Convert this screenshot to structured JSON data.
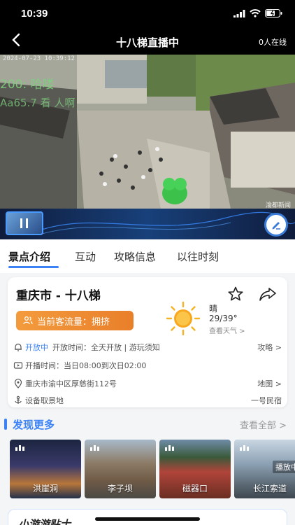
{
  "status": {
    "time": "10:39"
  },
  "nav": {
    "title": "十八梯直播中",
    "online": "0人在线"
  },
  "video": {
    "timestamp": "2024-07-23 10:39:12",
    "overlay_line1": "200: 哈喽",
    "overlay_line2": "Aa65.7 看 人啊",
    "watermark": "渝都新闻"
  },
  "tabs": [
    {
      "label": "景点介绍",
      "active": true
    },
    {
      "label": "互动",
      "active": false
    },
    {
      "label": "攻略信息",
      "active": false
    },
    {
      "label": "以往时刻",
      "active": false
    }
  ],
  "card": {
    "title": "重庆市 - 十八梯",
    "crowd_label": "当前客流量：拥挤",
    "weather": {
      "condition": "晴",
      "temp": "29/39°",
      "more": "查看天气 >"
    },
    "rows": [
      {
        "status": "开放中",
        "text": "开放时间：全天开放 | 游玩须知",
        "right": "攻略 >"
      },
      {
        "text": "开播时间：当日08:00到次日02:00",
        "right": ""
      },
      {
        "text": "重庆市渝中区厚慈街112号",
        "right": "地图 >"
      },
      {
        "text": "设备取景地",
        "right": "一号民宿"
      }
    ]
  },
  "discover": {
    "title": "发现更多",
    "view_all": "查看全部 >",
    "spots": [
      {
        "name": "洪崖洞",
        "live": ""
      },
      {
        "name": "李子坝",
        "live": ""
      },
      {
        "name": "磁器口",
        "live": ""
      },
      {
        "name": "长江索道",
        "live": "播放中"
      }
    ]
  },
  "tips": {
    "title": "小游游贴士"
  },
  "colors": {
    "accent": "#3b82f6",
    "crowd": "#ee8a33",
    "nav_bg": "#000000"
  }
}
